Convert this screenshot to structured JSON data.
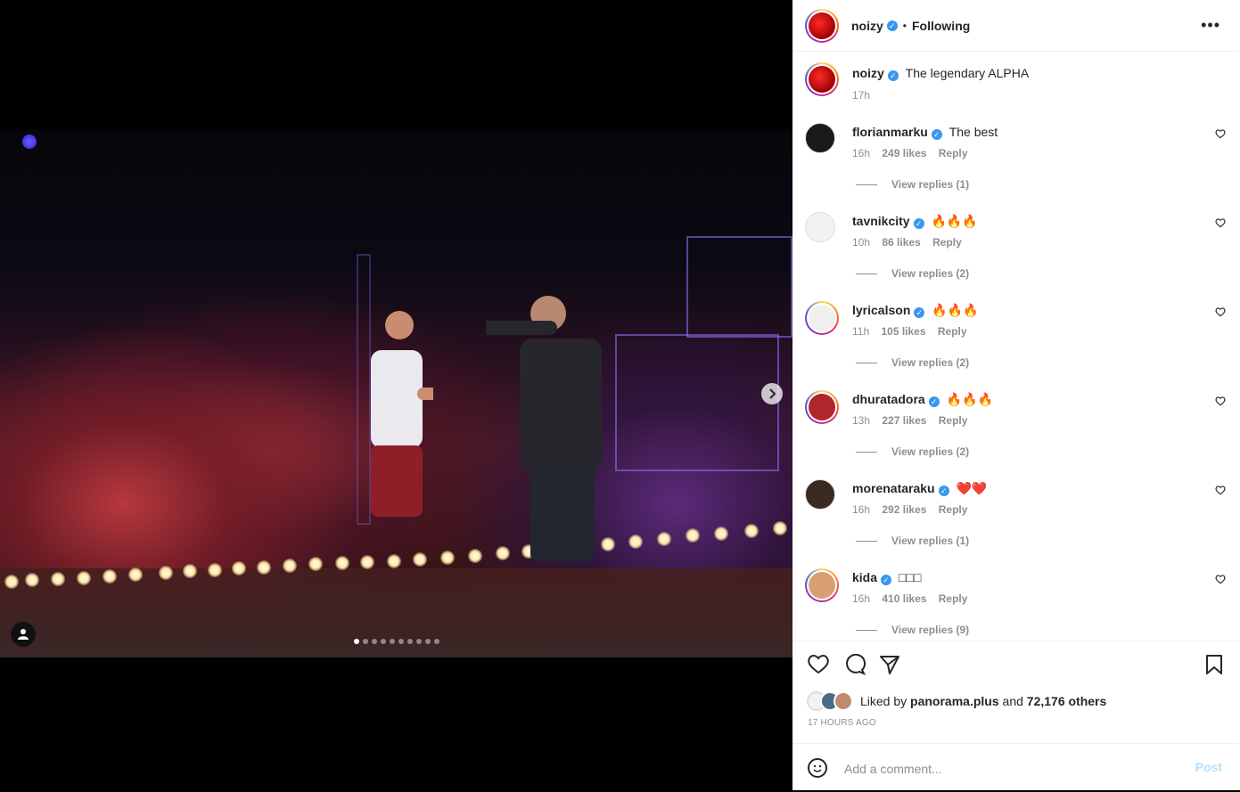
{
  "post": {
    "author": "noizy",
    "follow_status": "Following",
    "separator": "•",
    "more_icon": "more-horizontal-icon"
  },
  "carousel": {
    "slides_count": 10,
    "active_index": 0,
    "next_icon": "chevron-right-icon",
    "user_tag_icon": "person-icon"
  },
  "caption": {
    "username": "noizy",
    "text": "The legendary ALPHA",
    "time": "17h"
  },
  "comments": [
    {
      "username": "florianmarku",
      "text": "The best",
      "time": "16h",
      "likes": "249 likes",
      "reply": "Reply",
      "view_replies": "View replies (1)",
      "avatar_color": "#1a1a1a"
    },
    {
      "username": "tavnikcity",
      "text": "🔥🔥🔥",
      "time": "10h",
      "likes": "86 likes",
      "reply": "Reply",
      "view_replies": "View replies (2)",
      "avatar_color": "#f2f2f2"
    },
    {
      "username": "lyricalson",
      "text": "🔥🔥🔥",
      "time": "11h",
      "likes": "105 likes",
      "reply": "Reply",
      "view_replies": "View replies (2)",
      "avatar_color": "#efefef"
    },
    {
      "username": "dhuratadora",
      "text": "🔥🔥🔥",
      "time": "13h",
      "likes": "227 likes",
      "reply": "Reply",
      "view_replies": "View replies (2)",
      "avatar_color": "#b0272b"
    },
    {
      "username": "morenataraku",
      "text": "❤️❤️",
      "time": "16h",
      "likes": "292 likes",
      "reply": "Reply",
      "view_replies": "View replies (1)",
      "avatar_color": "#3a2a20"
    },
    {
      "username": "kida",
      "text": "□□□",
      "time": "16h",
      "likes": "410 likes",
      "reply": "Reply",
      "view_replies": "View replies (9)",
      "avatar_color": "#d8a070"
    }
  ],
  "actions": {
    "like_icon": "heart-icon",
    "comment_icon": "comment-icon",
    "share_icon": "send-icon",
    "save_icon": "bookmark-icon"
  },
  "likes": {
    "prefix": "Liked by",
    "user": "panorama.plus",
    "connector": "and",
    "others": "72,176 others"
  },
  "posted_ago": "17 HOURS AGO",
  "add_comment": {
    "placeholder": "Add a comment...",
    "post_label": "Post",
    "emoji_icon": "smiley-icon"
  },
  "colors": {
    "verified_blue": "#3897f0",
    "post_button": "#b2dffc",
    "muted_text": "#8e8e8e"
  }
}
